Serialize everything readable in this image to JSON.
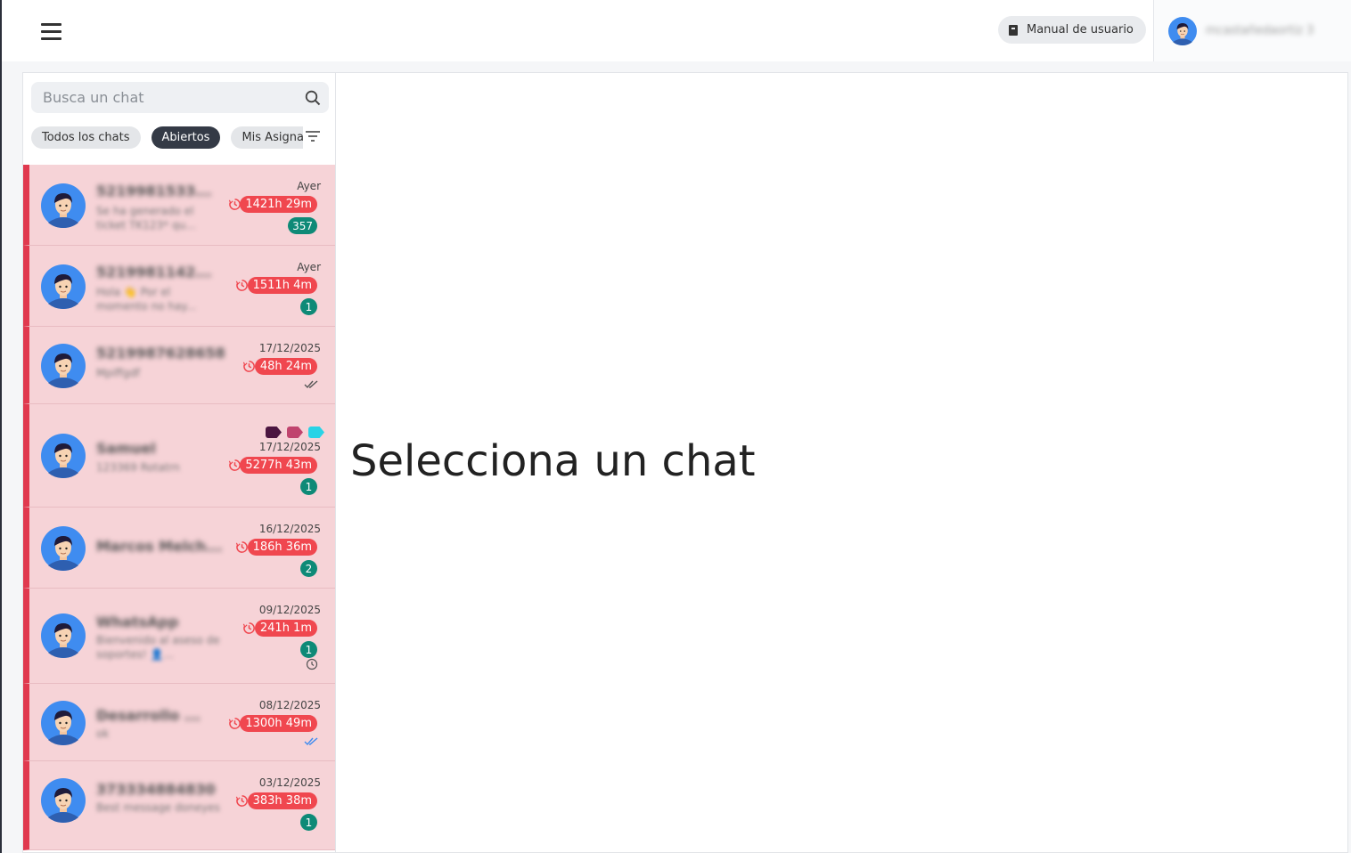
{
  "header": {
    "manual_label": "Manual de usuario",
    "user_name": "mcastañedaortiz 3"
  },
  "search": {
    "placeholder": "Busca un chat"
  },
  "filters": [
    "Todos los chats",
    "Abiertos",
    "Mis Asignados"
  ],
  "active_filter": "Abiertos",
  "chats": [
    {
      "name": "5219981533...",
      "message": "Se ha generado el ticket TK123* qu...",
      "date": "Ayer",
      "timer": "1421h 29m",
      "unread": "357"
    },
    {
      "name": "5219981142...",
      "message": "Hola 👋 Por el momento no hay...",
      "date": "Ayer",
      "timer": "1511h 4m",
      "unread": "1"
    },
    {
      "name": "5219987628658",
      "message": "Mpiffgdf",
      "date": "17/12/2025",
      "timer": "48h 24m",
      "status": "read-gray"
    },
    {
      "name": "Samuel",
      "message": "123369 Rotatrn",
      "date": "17/12/2025",
      "timer": "5277h 43m",
      "unread": "1",
      "tags": [
        "#4b1540",
        "#c0446e",
        "#29d3e6"
      ]
    },
    {
      "name": "Marcos Melch...",
      "message": "",
      "date": "16/12/2025",
      "timer": "186h 36m",
      "unread": "2"
    },
    {
      "name": "WhatsApp",
      "message": "Bienvenido al aseso de soportes! 👤...",
      "date": "09/12/2025",
      "timer": "241h 1m",
      "unread": "1",
      "status": "pending"
    },
    {
      "name": "Desarrollo ...",
      "message": "ok",
      "date": "08/12/2025",
      "timer": "1300h 49m",
      "status": "read-blue"
    },
    {
      "name": "373334884830",
      "message": "Best message doneyes",
      "date": "03/12/2025",
      "timer": "383h 38m",
      "unread": "1"
    }
  ],
  "main": {
    "placeholder_title": "Selecciona un chat"
  },
  "colors": {
    "row_bg": "#f6d3d7",
    "row_accent": "#e0394f",
    "timer": "#f0474f",
    "unread": "#0e8a77",
    "active_chip": "#343a46"
  }
}
